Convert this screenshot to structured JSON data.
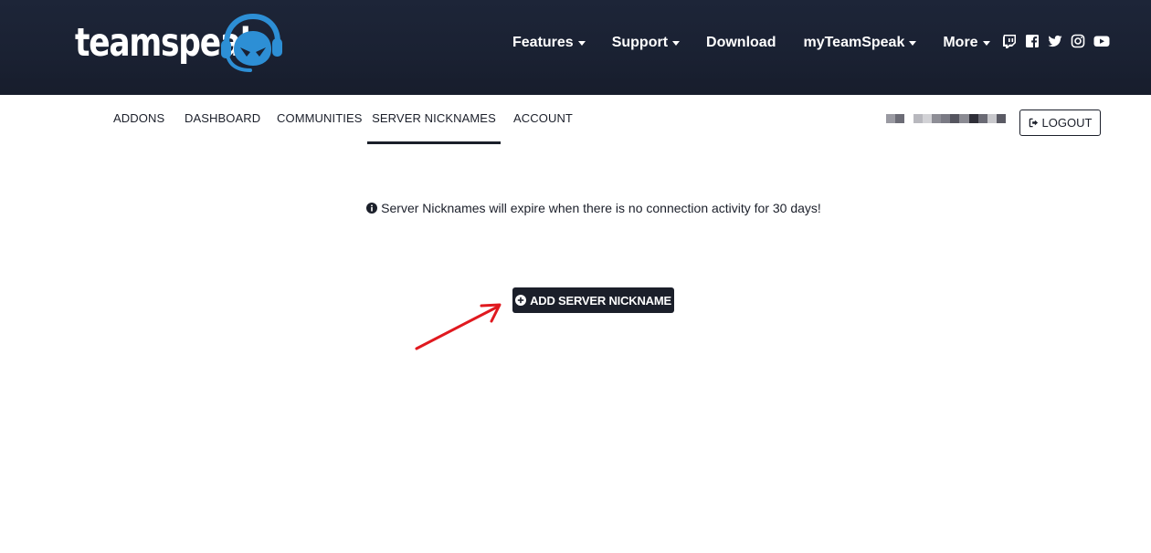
{
  "header": {
    "logo_text": "teamspeak",
    "nav": [
      {
        "label": "Features",
        "dropdown": true
      },
      {
        "label": "Support",
        "dropdown": true
      },
      {
        "label": "Download",
        "dropdown": false
      },
      {
        "label": "myTeamSpeak",
        "dropdown": true
      },
      {
        "label": "More",
        "dropdown": true
      }
    ],
    "social_icons": [
      "twitch-icon",
      "facebook-icon",
      "twitter-icon",
      "instagram-icon",
      "youtube-icon"
    ]
  },
  "subnav": {
    "tabs": [
      {
        "label": "ADDONS",
        "active": false
      },
      {
        "label": "DASHBOARD",
        "active": false
      },
      {
        "label": "COMMUNITIES",
        "active": false
      },
      {
        "label": "SERVER NICKNAMES",
        "active": true
      },
      {
        "label": "ACCOUNT",
        "active": false
      }
    ],
    "logout_label": "LOGOUT"
  },
  "main": {
    "notice_text": "Server Nicknames will expire when there is no connection activity for 30 days!",
    "add_button_label": "ADD SERVER NICKNAME"
  },
  "colors": {
    "header_bg": "#1a2132",
    "brand_blue": "#2d8fd5",
    "text_dark": "#1b1f2a",
    "annotation_arrow": "#e0191f"
  }
}
